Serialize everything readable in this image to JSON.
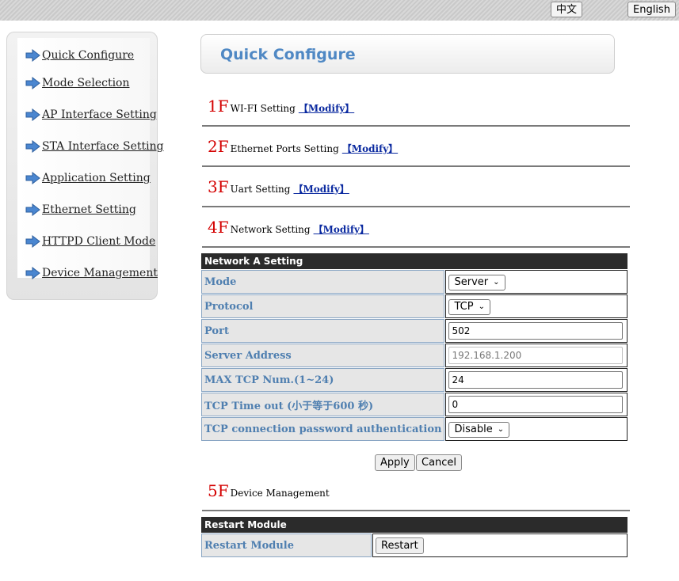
{
  "language": {
    "zh_label": "中文",
    "en_label": "English"
  },
  "sidebar": {
    "items": [
      {
        "label": "Quick Configure",
        "name": "sidebar-item-quick-configure"
      },
      {
        "label": "Mode Selection",
        "name": "sidebar-item-mode-selection"
      },
      {
        "label": "AP Interface Setting",
        "name": "sidebar-item-ap-interface"
      },
      {
        "label": "STA Interface Setting",
        "name": "sidebar-item-sta-interface"
      },
      {
        "label": "Application Setting",
        "name": "sidebar-item-application"
      },
      {
        "label": "Ethernet Setting",
        "name": "sidebar-item-ethernet"
      },
      {
        "label": "HTTPD Client Mode",
        "name": "sidebar-item-httpd-client"
      },
      {
        "label": "Device Management",
        "name": "sidebar-item-device-management"
      }
    ]
  },
  "page": {
    "title": "Quick Configure"
  },
  "sections": [
    {
      "floor": "1F",
      "label": "WI-FI Setting",
      "modify": "【Modify】"
    },
    {
      "floor": "2F",
      "label": "Ethernet Ports Setting",
      "modify": "【Modify】"
    },
    {
      "floor": "3F",
      "label": "Uart Setting",
      "modify": "【Modify】"
    },
    {
      "floor": "4F",
      "label": "Network Setting",
      "modify": "【Modify】"
    },
    {
      "floor": "5F",
      "label": "Device Management"
    }
  ],
  "network": {
    "heading": "Network A Setting",
    "mode": {
      "label": "Mode",
      "value": "Server"
    },
    "protocol": {
      "label": "Protocol",
      "value": "TCP"
    },
    "port": {
      "label": "Port",
      "value": "502"
    },
    "server_address": {
      "label": "Server Address",
      "value": "192.168.1.200"
    },
    "max_tcp": {
      "label": "MAX TCP Num.(1~24)",
      "value": "24"
    },
    "tcp_timeout": {
      "label": "TCP Time out (小于等于600 秒)",
      "value": "0"
    },
    "tcp_password": {
      "label": "TCP connection password authentication",
      "value": "Disable"
    },
    "apply_label": "Apply",
    "cancel_label": "Cancel"
  },
  "restart": {
    "heading": "Restart Module",
    "label": "Restart Module",
    "button_label": "Restart"
  },
  "colors": {
    "floor": "#d40000",
    "label_text": "#4f7fb0",
    "title": "#4f88c4",
    "table_head": "#2b2b2b"
  }
}
